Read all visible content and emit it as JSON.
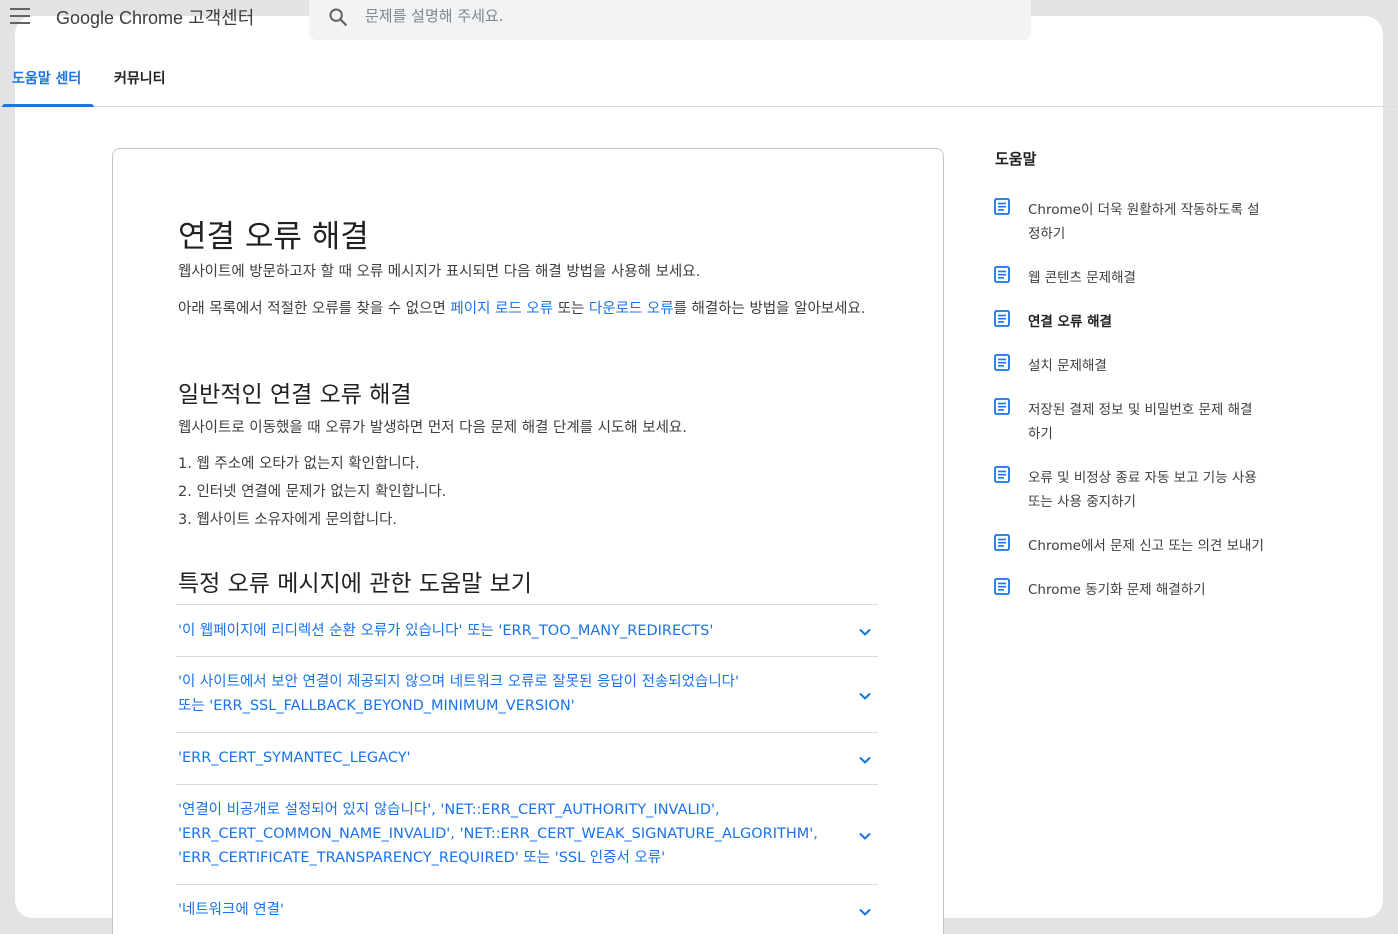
{
  "header": {
    "site_title": "Google Chrome 고객센터",
    "search_placeholder": "문제를 설명해 주세요."
  },
  "tabs": [
    {
      "label": "도움말 센터",
      "active": true
    },
    {
      "label": "커뮤니티",
      "active": false
    }
  ],
  "article": {
    "title": "연결 오류 해결",
    "intro": "웹사이트에 방문하고자 할 때 오류 메시지가 표시되면 다음 해결 방법을 사용해 보세요.",
    "para2": {
      "before": "아래 목록에서 적절한 오류를 찾을 수 없으면 ",
      "link1": "페이지 로드 오류",
      "middle": " 또는 ",
      "link2": "다운로드 오류",
      "after": "를 해결하는 방법을 알아보세요."
    },
    "section1_title": "일반적인 연결 오류 해결",
    "section1_intro": "웹사이트로 이동했을 때 오류가 발생하면 먼저 다음 문제 해결 단계를 시도해 보세요.",
    "steps": [
      "1. 웹 주소에 오타가 없는지 확인합니다.",
      "2. 인터넷 연결에 문제가 없는지 확인합니다.",
      "3. 웹사이트 소유자에게 문의합니다."
    ],
    "section2_title": "특정 오류 메시지에 관한 도움말 보기",
    "accordion": [
      {
        "lines": [
          "'이 웹페이지에 리디렉션 순환 오류가 있습니다' 또는 'ERR_TOO_MANY_REDIRECTS'"
        ]
      },
      {
        "lines": [
          "'이 사이트에서 보안 연결이 제공되지 않으며 네트워크 오류로 잘못된 응답이 전송되었습니다'",
          "또는 'ERR_SSL_FALLBACK_BEYOND_MINIMUM_VERSION'"
        ]
      },
      {
        "lines": [
          "'ERR_CERT_SYMANTEC_LEGACY'"
        ]
      },
      {
        "lines": [
          "'연결이 비공개로 설정되어 있지 않습니다', 'NET::ERR_CERT_AUTHORITY_INVALID',",
          "'ERR_CERT_COMMON_NAME_INVALID', 'NET::ERR_CERT_WEAK_SIGNATURE_ALGORITHM',",
          "'ERR_CERTIFICATE_TRANSPARENCY_REQUIRED' 또는 'SSL 인증서 오류'"
        ]
      },
      {
        "lines": [
          "'네트워크에 연결'"
        ]
      }
    ]
  },
  "sidebar": {
    "title": "도움말",
    "items": [
      {
        "lines": [
          "Chrome이 더욱 원활하게 작동하도록 설",
          "정하기"
        ],
        "active": false
      },
      {
        "lines": [
          "웹 콘텐츠 문제해결"
        ],
        "active": false
      },
      {
        "lines": [
          "연결 오류 해결"
        ],
        "active": true
      },
      {
        "lines": [
          "설치 문제해결"
        ],
        "active": false
      },
      {
        "lines": [
          "저장된 결제 정보 및 비밀번호 문제 해결",
          "하기"
        ],
        "active": false
      },
      {
        "lines": [
          "오류 및 비정상 종료 자동 보고 기능 사용",
          "또는 사용 중지하기"
        ],
        "active": false
      },
      {
        "lines": [
          "Chrome에서 문제 신고 또는 의견 보내기"
        ],
        "active": false
      },
      {
        "lines": [
          "Chrome 동기화 문제 해결하기"
        ],
        "active": false
      }
    ]
  },
  "colors": {
    "accent": "#1a73e8",
    "text": "#202124",
    "muted": "#3c4043",
    "backdrop": "#e3e3e3"
  },
  "icons": {
    "menu": "hamburger-menu-icon",
    "search": "search-icon",
    "chevron": "chevron-down-icon",
    "article": "article-doc-icon"
  }
}
